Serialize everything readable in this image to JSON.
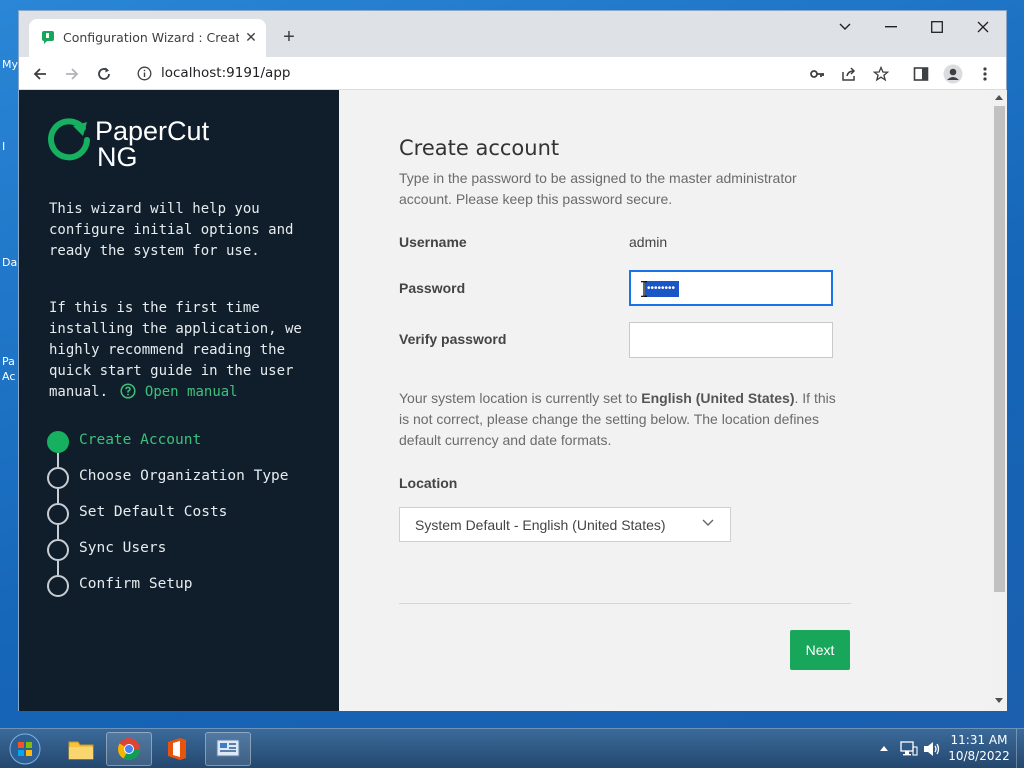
{
  "desktop": {
    "icon_labels": [
      "My",
      "I",
      "Da",
      "Pa",
      "Ac"
    ]
  },
  "browser": {
    "tab_title": "Configuration Wizard : Create ac",
    "url": "localhost:9191/app"
  },
  "sidebar": {
    "logo_name": "PaperCut",
    "logo_sub": "NG",
    "intro": "This wizard will help you configure initial options and ready the system for use.",
    "guide_text": "If this is the first time installing the application, we highly recommend reading the quick start guide in the user manual.",
    "open_manual": "Open manual",
    "steps": [
      {
        "label": "Create Account",
        "active": true
      },
      {
        "label": "Choose Organization Type",
        "active": false
      },
      {
        "label": "Set Default Costs",
        "active": false
      },
      {
        "label": "Sync Users",
        "active": false
      },
      {
        "label": "Confirm Setup",
        "active": false
      }
    ]
  },
  "form": {
    "title": "Create account",
    "description": "Type in the password to be assigned to the master administrator account. Please keep this password secure.",
    "username_label": "Username",
    "username_value": "admin",
    "password_label": "Password",
    "password_value": "••••••••",
    "verify_label": "Verify password",
    "verify_value": "",
    "location_note_prefix": "Your system location is currently set to",
    "location_current": "English (United States)",
    "location_note_suffix": ". If this is not correct, please change the setting below. The location defines default currency and date formats.",
    "location_label": "Location",
    "location_selected": "System Default - English (United States)",
    "next_label": "Next"
  },
  "taskbar": {
    "time": "11:31 AM",
    "date": "10/8/2022"
  },
  "colors": {
    "sidebar_bg": "#101e2b",
    "accent_green": "#17a65a",
    "link_green": "#3ec07a"
  }
}
